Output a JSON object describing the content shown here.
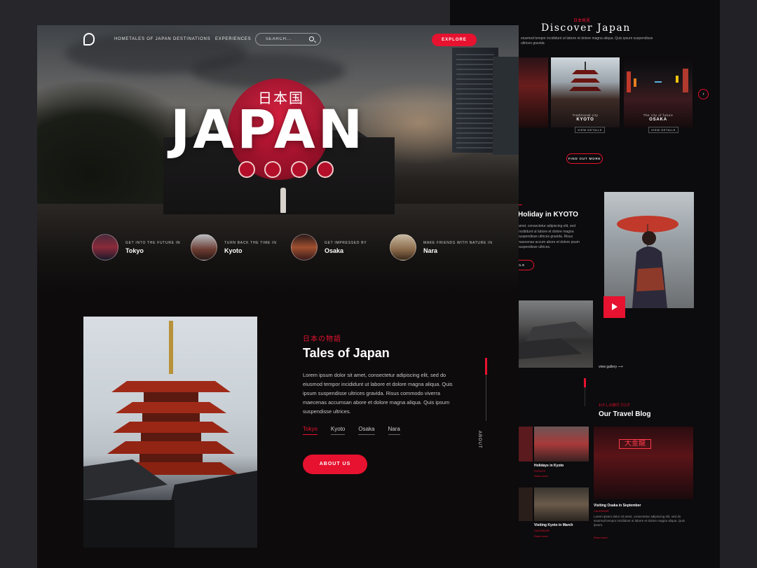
{
  "nav": {
    "logo": "G",
    "links": [
      "HOMETALES OF JAPAN",
      "DESTINATIONS",
      "EXPERIENCES"
    ],
    "search_placeholder": "SEARCH...",
    "explore_label": "EXPLORE"
  },
  "hero": {
    "kanji": "日本国",
    "title": "JAPAN"
  },
  "destinations": [
    {
      "caption": "GET INTO THE FUTURE IN",
      "name": "Tokyo"
    },
    {
      "caption": "TURN BACK THE TIME IN",
      "name": "Kyoto"
    },
    {
      "caption": "GET IMPRESSED BY",
      "name": "Osaka"
    },
    {
      "caption": "MAKE FRIENDS WITH NATURE IN",
      "name": "Nara"
    }
  ],
  "tales": {
    "kicker": "日本の物語",
    "title": "Tales of Japan",
    "body": "Lorem ipsum dolor sit amet, consectetur adipiscing elit, sed do eiusmod tempor incididunt ut labore et dolore magna aliqua. Quis ipsum suspendisse ultrices gravida. Risus commodo viverra maecenas accumsan abore et dolore magna aliqua. Quis ipsum suspendisse ultrices.",
    "tabs": [
      "Tokyo",
      "Kyoto",
      "Osaka",
      "Nara"
    ],
    "active_tab": "Tokyo",
    "cta": "ABOUT US",
    "side_label": "ABOUT"
  },
  "right": {
    "kicker": "日本発見",
    "title": "Discover Japan",
    "subtitle": "eiusmod tempor incididunt ut labore et dolore magna aliqua. Quis ipsum suspendisse ultrices gravida",
    "cities": [
      {
        "caption": "Traditional city",
        "name": "KYOTO",
        "button": "VIEW DETAILS"
      },
      {
        "caption": "The city of future",
        "name": "OSAKA",
        "button": "VIEW DETAILS"
      }
    ],
    "find_more": "FIND OUT MORE",
    "kyoto_heading": "Holiday in KYOTO",
    "kyoto_body": "amet, consectetur adipiscing elit, sed incididunt ut labore et dolore magna suspendisse ultrices gravida. Risus maecenas accum abore et dolore psum suspendisse ultrices.",
    "read_more": "AILS",
    "view_gallery": "view gallery",
    "blog_kicker": "わたしの旅行ブログ",
    "blog_title": "Our Travel Blog",
    "posts": [
      {
        "title": "Holidays in Kyoto",
        "meta": "EVENTS",
        "more": "Read more"
      },
      {
        "title": "Visiting Osaka in September",
        "meta": "CALENDAR",
        "more": "Read more"
      },
      {
        "title": "Visiting Kyoto in March",
        "meta": "CALENDAR",
        "more": "Read more"
      }
    ]
  },
  "colors": {
    "accent": "#e6122f",
    "bg": "#0d0b0c",
    "outer": "#222226"
  }
}
